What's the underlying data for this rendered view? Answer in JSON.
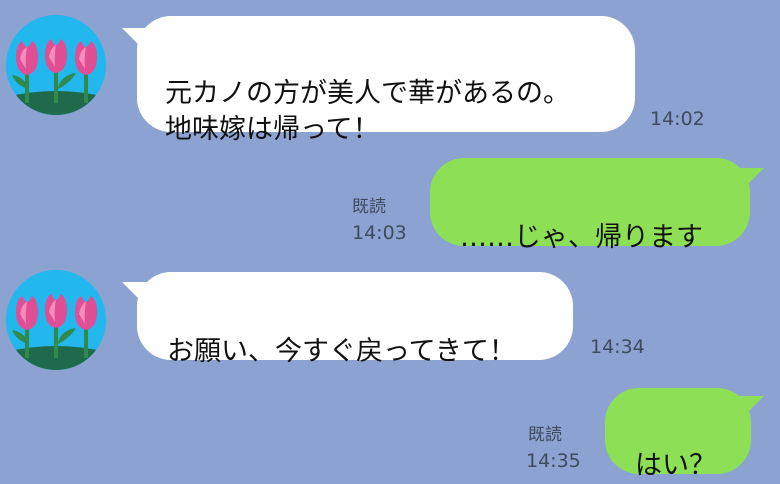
{
  "messages": [
    {
      "side": "received",
      "text": "元カノの方が美人で華があるの。\n地味嫁は帰って！",
      "time": "14:02"
    },
    {
      "side": "sent",
      "text": "……じゃ、帰ります",
      "read": "既読",
      "time": "14:03"
    },
    {
      "side": "received",
      "text": "お願い、今すぐ戻ってきて！",
      "time": "14:34"
    },
    {
      "side": "sent",
      "text": "はい？",
      "read": "既読",
      "time": "14:35"
    }
  ],
  "colors": {
    "background": "#8ca3d1",
    "received_bubble": "#ffffff",
    "sent_bubble": "#8de055",
    "avatar_bg": "#22b8ee"
  },
  "icons": {
    "avatar": "tulips-avatar-icon"
  }
}
